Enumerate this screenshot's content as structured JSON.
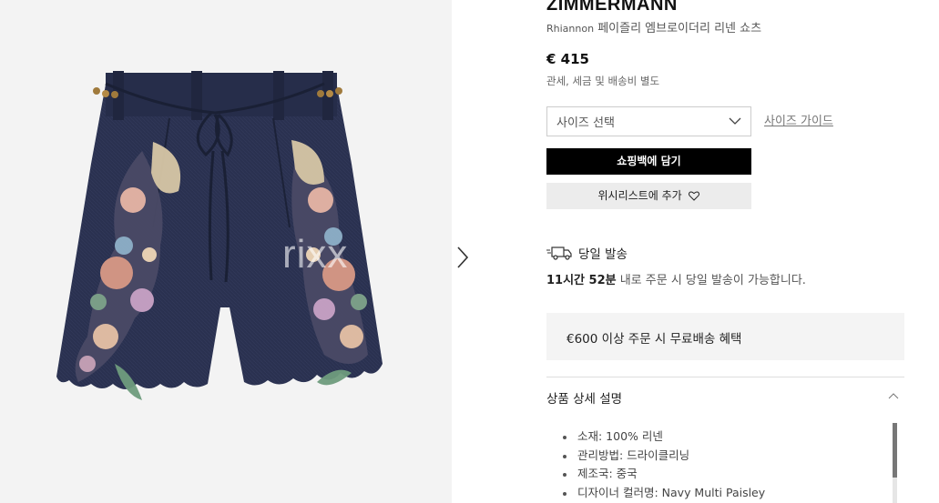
{
  "gallery": {
    "watermark": "rixx"
  },
  "product": {
    "brand": "ZIMMERMANN",
    "name_latin": "Rhiannon",
    "name": "페이즐리 엠브로이더리 리넨 쇼츠",
    "price": "€ 415",
    "tax_note": "관세, 세금 및 배송비 별도"
  },
  "size": {
    "select_label": "사이즈 선택",
    "guide_label": "사이즈 가이드"
  },
  "actions": {
    "add_to_bag": "쇼핑백에 담기",
    "wishlist": "위시리스트에 추가"
  },
  "delivery": {
    "title": "당일 발송",
    "time_bold": "11시간 52분",
    "time_rest": " 내로 주문 시 당일 발송이 가능합니다."
  },
  "free_shipping": "€600 이상 주문 시 무료배송 혜택",
  "details": {
    "title": "상품 상세 설명",
    "items": [
      "소재: 100% 리넨",
      "관리방법: 드라이클리닝",
      "제조국: 중국",
      "디자이너 컬러명: Navy Multi Paisley"
    ]
  },
  "colors": {
    "bag_button_bg": "#000000",
    "wishlist_bg": "#ececec",
    "gallery_bg": "#f3f3f3",
    "shorts_navy": "#2a3150"
  },
  "icons": [
    "chevron-right-icon",
    "chevron-down-icon",
    "heart-icon",
    "truck-icon",
    "chevron-up-icon"
  ]
}
